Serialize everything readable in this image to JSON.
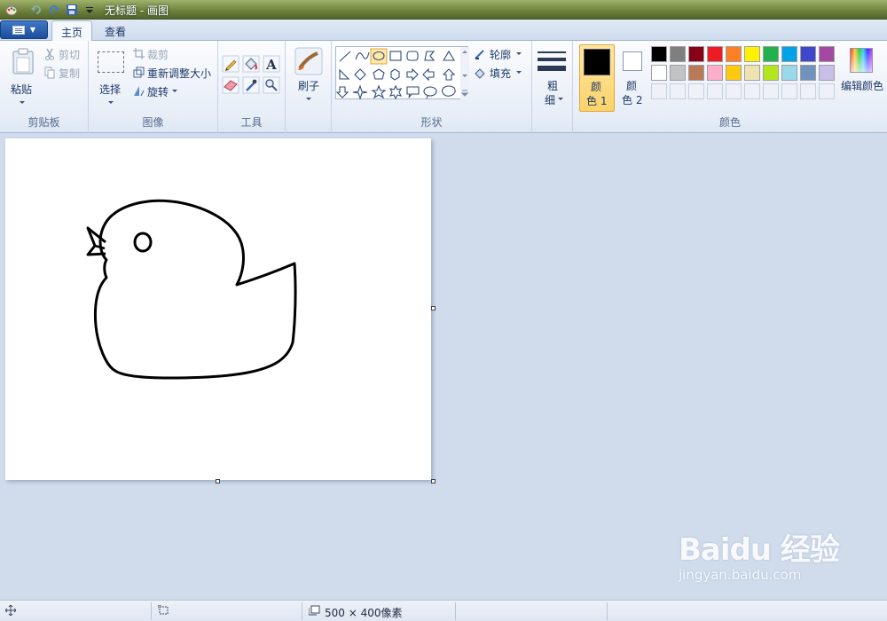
{
  "window": {
    "title": "无标题 - 画图"
  },
  "tabs": [
    {
      "label": "主页"
    },
    {
      "label": "查看"
    }
  ],
  "clipboard": {
    "paste": "粘贴",
    "cut": "剪切",
    "copy": "复制",
    "group": "剪贴板"
  },
  "image": {
    "select": "选择",
    "crop": "裁剪",
    "resize": "重新调整大小",
    "rotate": "旋转",
    "group": "图像"
  },
  "tools": {
    "group": "工具"
  },
  "brushes": {
    "label": "刷子"
  },
  "shapes": {
    "outline": "轮廓",
    "fill": "填充",
    "group": "形状"
  },
  "size": {
    "label1": "粗",
    "label2": "细"
  },
  "colors": {
    "color1_a": "颜",
    "color1_b": "色 1",
    "color2_a": "颜",
    "color2_b": "色 2",
    "edit": "编辑颜色",
    "group": "颜色",
    "color1_value": "#000000",
    "color2_value": "#ffffff",
    "palette_row1": [
      "#000000",
      "#7f7f7f",
      "#880015",
      "#ed1c24",
      "#ff7f27",
      "#fff200",
      "#22b14c",
      "#00a2e8",
      "#3f48cc",
      "#a349a4"
    ],
    "palette_row2": [
      "#ffffff",
      "#c3c3c3",
      "#b97a57",
      "#ffaec9",
      "#ffc90e",
      "#efe4b0",
      "#b5e61d",
      "#99d9ea",
      "#7092be",
      "#c8bfe7"
    ]
  },
  "status": {
    "canvas_size": "500 × 400像素"
  },
  "watermark": {
    "logo": "Baidu 经验",
    "url": "jingyan.baidu.com"
  }
}
